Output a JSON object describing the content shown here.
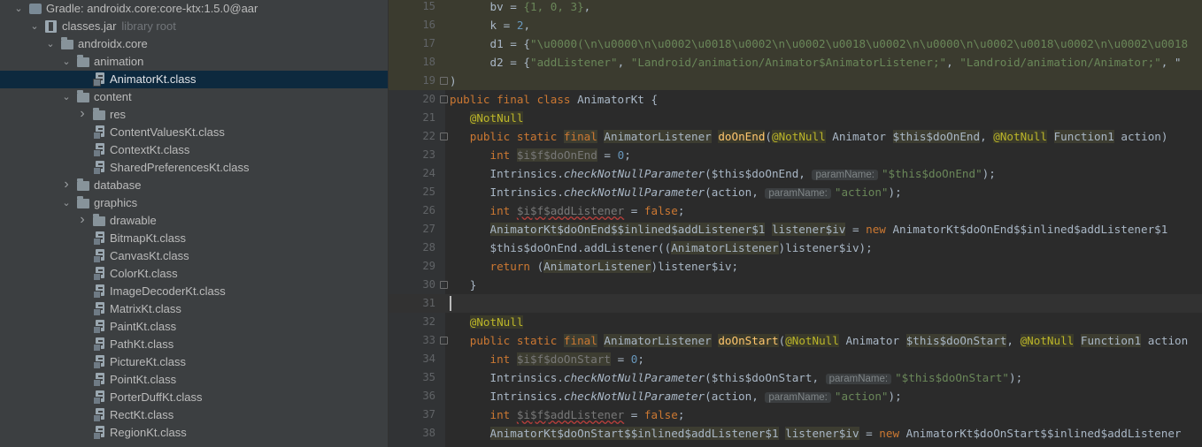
{
  "project_tree": {
    "items": [
      {
        "label": "Gradle: androidx.core:core-ktx:1.5.0@aar",
        "sub": "",
        "icon": "gradle-library-icon",
        "depth": 0,
        "expanded": true,
        "type": "library"
      },
      {
        "label": "classes.jar",
        "sub": "library root",
        "icon": "jar-icon",
        "depth": 1,
        "expanded": true,
        "type": "jar"
      },
      {
        "label": "androidx.core",
        "sub": "",
        "icon": "package-folder-icon",
        "depth": 2,
        "expanded": true,
        "type": "folder"
      },
      {
        "label": "animation",
        "sub": "",
        "icon": "package-folder-icon",
        "depth": 3,
        "expanded": true,
        "type": "folder"
      },
      {
        "label": "AnimatorKt.class",
        "sub": "",
        "icon": "class-file-icon",
        "depth": 4,
        "selected": true,
        "type": "class"
      },
      {
        "label": "content",
        "sub": "",
        "icon": "package-folder-icon",
        "depth": 3,
        "expanded": true,
        "type": "folder"
      },
      {
        "label": "res",
        "sub": "",
        "icon": "package-folder-icon",
        "depth": 4,
        "expanded": false,
        "type": "folder"
      },
      {
        "label": "ContentValuesKt.class",
        "sub": "",
        "icon": "class-file-icon",
        "depth": 4,
        "type": "class"
      },
      {
        "label": "ContextKt.class",
        "sub": "",
        "icon": "class-file-icon",
        "depth": 4,
        "type": "class"
      },
      {
        "label": "SharedPreferencesKt.class",
        "sub": "",
        "icon": "class-file-icon",
        "depth": 4,
        "type": "class"
      },
      {
        "label": "database",
        "sub": "",
        "icon": "package-folder-icon",
        "depth": 3,
        "expanded": false,
        "type": "folder"
      },
      {
        "label": "graphics",
        "sub": "",
        "icon": "package-folder-icon",
        "depth": 3,
        "expanded": true,
        "type": "folder"
      },
      {
        "label": "drawable",
        "sub": "",
        "icon": "package-folder-icon",
        "depth": 4,
        "expanded": false,
        "type": "folder"
      },
      {
        "label": "BitmapKt.class",
        "sub": "",
        "icon": "class-file-icon",
        "depth": 4,
        "type": "class"
      },
      {
        "label": "CanvasKt.class",
        "sub": "",
        "icon": "class-file-icon",
        "depth": 4,
        "type": "class"
      },
      {
        "label": "ColorKt.class",
        "sub": "",
        "icon": "class-file-icon",
        "depth": 4,
        "type": "class"
      },
      {
        "label": "ImageDecoderKt.class",
        "sub": "",
        "icon": "class-file-icon",
        "depth": 4,
        "type": "class"
      },
      {
        "label": "MatrixKt.class",
        "sub": "",
        "icon": "class-file-icon",
        "depth": 4,
        "type": "class"
      },
      {
        "label": "PaintKt.class",
        "sub": "",
        "icon": "class-file-icon",
        "depth": 4,
        "type": "class"
      },
      {
        "label": "PathKt.class",
        "sub": "",
        "icon": "class-file-icon",
        "depth": 4,
        "type": "class"
      },
      {
        "label": "PictureKt.class",
        "sub": "",
        "icon": "class-file-icon",
        "depth": 4,
        "type": "class"
      },
      {
        "label": "PointKt.class",
        "sub": "",
        "icon": "class-file-icon",
        "depth": 4,
        "type": "class"
      },
      {
        "label": "PorterDuffKt.class",
        "sub": "",
        "icon": "class-file-icon",
        "depth": 4,
        "type": "class"
      },
      {
        "label": "RectKt.class",
        "sub": "",
        "icon": "class-file-icon",
        "depth": 4,
        "type": "class"
      },
      {
        "label": "RegionKt.class",
        "sub": "",
        "icon": "class-file-icon",
        "depth": 4,
        "type": "class"
      }
    ]
  },
  "editor": {
    "colors": {
      "background": "#2b2b2b",
      "keyword": "#cc7832",
      "string": "#6a8759",
      "annotation": "#bbb529",
      "method": "#ffc66d",
      "number": "#6897bb",
      "field": "#9876aa"
    },
    "line_numbers": [
      "15",
      "16",
      "17",
      "18",
      "19",
      "20",
      "21",
      "22",
      "23",
      "24",
      "25",
      "26",
      "27",
      "28",
      "29",
      "30",
      "31",
      "32",
      "33",
      "34",
      "35",
      "36",
      "37",
      "38"
    ],
    "inlay_param_name": "paramName:",
    "lines": [
      {
        "indent": "      ",
        "tokens": [
          [
            "",
            "bv = "
          ],
          [
            "str",
            "{1, 0, 3}"
          ],
          [
            "",
            ","
          ]
        ],
        "hl": true
      },
      {
        "indent": "      ",
        "tokens": [
          [
            "",
            "k = "
          ],
          [
            "num",
            "2"
          ],
          [
            "",
            ","
          ]
        ],
        "hl": true
      },
      {
        "indent": "      ",
        "tokens": [
          [
            "",
            "d1 = {"
          ],
          [
            "str",
            "\"\\u0000(\\n\\u0000\\n\\u0002\\u0018\\u0002\\n\\u0002\\u0018\\u0002\\n\\u0000\\n\\u0002\\u0018\\u0002\\n\\u0002\\u0018"
          ]
        ],
        "hl": true
      },
      {
        "indent": "      ",
        "tokens": [
          [
            "",
            "d2 = {"
          ],
          [
            "str",
            "\"addListener\""
          ],
          [
            "",
            ", "
          ],
          [
            "str",
            "\"Landroid/animation/Animator$AnimatorListener;\""
          ],
          [
            "",
            ", "
          ],
          [
            "str",
            "\"Landroid/animation/Animator;\""
          ],
          [
            "",
            ", \""
          ]
        ],
        "hl": true
      },
      {
        "indent": "",
        "tokens": [
          [
            "",
            ")"
          ]
        ],
        "hl": true,
        "fold": true
      },
      {
        "indent": "",
        "tokens": [
          [
            "kw",
            "public final class "
          ],
          [
            "",
            "AnimatorKt {"
          ]
        ],
        "fold": true
      },
      {
        "indent": "   ",
        "tokens": [
          [
            "ann",
            "@NotNull"
          ]
        ]
      },
      {
        "indent": "   ",
        "tokens": [
          [
            "kw",
            "public static "
          ],
          [
            "kw box",
            "final"
          ],
          [
            "",
            " "
          ],
          [
            "box",
            "AnimatorListener"
          ],
          [
            "",
            " "
          ],
          [
            "fn",
            "doOnEnd"
          ],
          [
            "",
            "("
          ],
          [
            "ann",
            "@NotNull"
          ],
          [
            "",
            " Animator "
          ],
          [
            "box",
            "$this$doOnEnd"
          ],
          [
            "",
            ", "
          ],
          [
            "ann",
            "@NotNull"
          ],
          [
            "",
            " "
          ],
          [
            "box",
            "Function1"
          ],
          [
            "",
            " action)"
          ]
        ],
        "fold": true
      },
      {
        "indent": "      ",
        "tokens": [
          [
            "kw",
            "int "
          ],
          [
            "grey box",
            "$i$f$doOnEnd"
          ],
          [
            "",
            " = "
          ],
          [
            "num",
            "0"
          ],
          [
            "",
            ";"
          ]
        ]
      },
      {
        "indent": "      ",
        "tokens": [
          [
            "",
            "Intrinsics."
          ],
          [
            "it",
            "checkNotNullParameter"
          ],
          [
            "",
            "($this$doOnEnd, "
          ],
          [
            "hint",
            "paramName:"
          ],
          [
            "str",
            "\"$this$doOnEnd\""
          ],
          [
            "",
            ");"
          ]
        ]
      },
      {
        "indent": "      ",
        "tokens": [
          [
            "",
            "Intrinsics."
          ],
          [
            "it",
            "checkNotNullParameter"
          ],
          [
            "",
            "(action, "
          ],
          [
            "hint",
            "paramName:"
          ],
          [
            "str",
            "\"action\""
          ],
          [
            "",
            ");"
          ]
        ]
      },
      {
        "indent": "      ",
        "tokens": [
          [
            "kw",
            "int "
          ],
          [
            "grey und",
            "$i$f$addListener"
          ],
          [
            "",
            " = "
          ],
          [
            "kw",
            "false"
          ],
          [
            "",
            ";"
          ]
        ]
      },
      {
        "indent": "      ",
        "tokens": [
          [
            "box",
            "AnimatorKt$doOnEnd$$inlined$addListener$1"
          ],
          [
            "",
            " "
          ],
          [
            "box",
            "listener$iv"
          ],
          [
            "",
            " = "
          ],
          [
            "kw",
            "new "
          ],
          [
            "",
            "AnimatorKt$doOnEnd$$inlined$addListener$1"
          ]
        ]
      },
      {
        "indent": "      ",
        "tokens": [
          [
            "",
            "$this$doOnEnd.addListener(("
          ],
          [
            "box",
            "AnimatorListener"
          ],
          [
            "",
            ")listener$iv);"
          ]
        ]
      },
      {
        "indent": "      ",
        "tokens": [
          [
            "kw",
            "return "
          ],
          [
            "",
            "("
          ],
          [
            "box",
            "AnimatorListener"
          ],
          [
            "",
            ")listener$iv;"
          ]
        ]
      },
      {
        "indent": "   ",
        "tokens": [
          [
            "",
            "}"
          ]
        ],
        "fold": true
      },
      {
        "indent": "",
        "tokens": [
          [
            "",
            ""
          ]
        ],
        "caret": true
      },
      {
        "indent": "   ",
        "tokens": [
          [
            "ann",
            "@NotNull"
          ]
        ]
      },
      {
        "indent": "   ",
        "tokens": [
          [
            "kw",
            "public static "
          ],
          [
            "kw box",
            "final"
          ],
          [
            "",
            " "
          ],
          [
            "box",
            "AnimatorListener"
          ],
          [
            "",
            " "
          ],
          [
            "fn",
            "doOnStart"
          ],
          [
            "",
            "("
          ],
          [
            "ann",
            "@NotNull"
          ],
          [
            "",
            " Animator "
          ],
          [
            "box",
            "$this$doOnStart"
          ],
          [
            "",
            ", "
          ],
          [
            "ann",
            "@NotNull"
          ],
          [
            "",
            " "
          ],
          [
            "box",
            "Function1"
          ],
          [
            "",
            " action"
          ]
        ],
        "fold": true
      },
      {
        "indent": "      ",
        "tokens": [
          [
            "kw",
            "int "
          ],
          [
            "grey box",
            "$i$f$doOnStart"
          ],
          [
            "",
            " = "
          ],
          [
            "num",
            "0"
          ],
          [
            "",
            ";"
          ]
        ]
      },
      {
        "indent": "      ",
        "tokens": [
          [
            "",
            "Intrinsics."
          ],
          [
            "it",
            "checkNotNullParameter"
          ],
          [
            "",
            "($this$doOnStart, "
          ],
          [
            "hint",
            "paramName:"
          ],
          [
            "str",
            "\"$this$doOnStart\""
          ],
          [
            "",
            ");"
          ]
        ]
      },
      {
        "indent": "      ",
        "tokens": [
          [
            "",
            "Intrinsics."
          ],
          [
            "it",
            "checkNotNullParameter"
          ],
          [
            "",
            "(action, "
          ],
          [
            "hint",
            "paramName:"
          ],
          [
            "str",
            "\"action\""
          ],
          [
            "",
            ");"
          ]
        ]
      },
      {
        "indent": "      ",
        "tokens": [
          [
            "kw",
            "int "
          ],
          [
            "grey und",
            "$i$f$addListener"
          ],
          [
            "",
            " = "
          ],
          [
            "kw",
            "false"
          ],
          [
            "",
            ";"
          ]
        ]
      },
      {
        "indent": "      ",
        "tokens": [
          [
            "box",
            "AnimatorKt$doOnStart$$inlined$addListener$1"
          ],
          [
            "",
            " "
          ],
          [
            "box",
            "listener$iv"
          ],
          [
            "",
            " = "
          ],
          [
            "kw",
            "new "
          ],
          [
            "",
            "AnimatorKt$doOnStart$$inlined$addListener"
          ]
        ]
      }
    ]
  }
}
